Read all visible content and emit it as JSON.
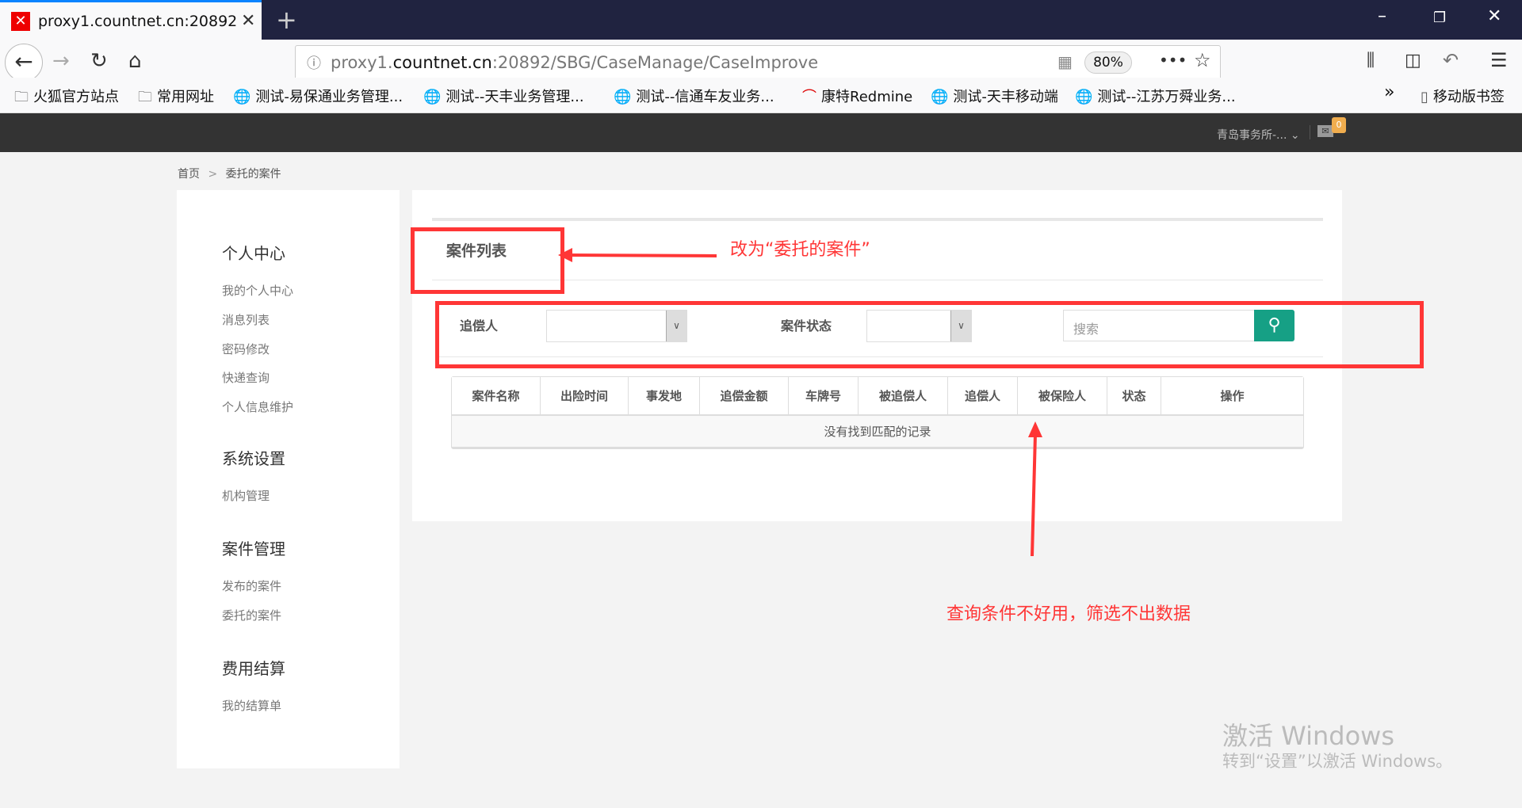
{
  "browser": {
    "tab_title": "proxy1.countnet.cn:20892/SBG/CaseManage/CaseImprove",
    "url_prefix": "proxy1.",
    "url_domain": "countnet.cn",
    "url_path": ":20892/SBG/CaseManage/CaseImprove",
    "zoom": "80%",
    "bookmarks": [
      "火狐官方站点",
      "常用网址",
      "测试-易保通业务管理...",
      "测试--天丰业务管理...",
      "测试--信通车友业务...",
      "康特Redmine",
      "测试-天丰移动端",
      "测试--江苏万舜业务..."
    ],
    "mobile_bookmarks": "移动版书签"
  },
  "header": {
    "org": "青岛事务所-...",
    "mail_count": "0"
  },
  "breadcrumb": {
    "home": "首页",
    "sep": ">",
    "current": "委托的案件"
  },
  "sidebar": {
    "groups": [
      {
        "title": "个人中心",
        "items": [
          "我的个人中心",
          "消息列表",
          "密码修改",
          "快递查询",
          "个人信息维护"
        ]
      },
      {
        "title": "系统设置",
        "items": [
          "机构管理"
        ]
      },
      {
        "title": "案件管理",
        "items": [
          "发布的案件",
          "委托的案件"
        ]
      },
      {
        "title": "费用结算",
        "items": [
          "我的结算单"
        ]
      }
    ]
  },
  "main": {
    "title": "案件列表",
    "filters": {
      "claimant_label": "追偿人",
      "status_label": "案件状态",
      "search_placeholder": "搜索"
    },
    "table": {
      "columns": [
        "案件名称",
        "出险时间",
        "事发地",
        "追偿金额",
        "车牌号",
        "被追偿人",
        "追偿人",
        "被保险人",
        "状态",
        "操作"
      ],
      "empty": "没有找到匹配的记录"
    }
  },
  "annotations": {
    "rename": "改为“委托的案件”",
    "filter_issue": "查询条件不好用，筛选不出数据"
  },
  "watermark": {
    "line1": "激活 Windows",
    "line2": "转到“设置”以激活 Windows。"
  }
}
